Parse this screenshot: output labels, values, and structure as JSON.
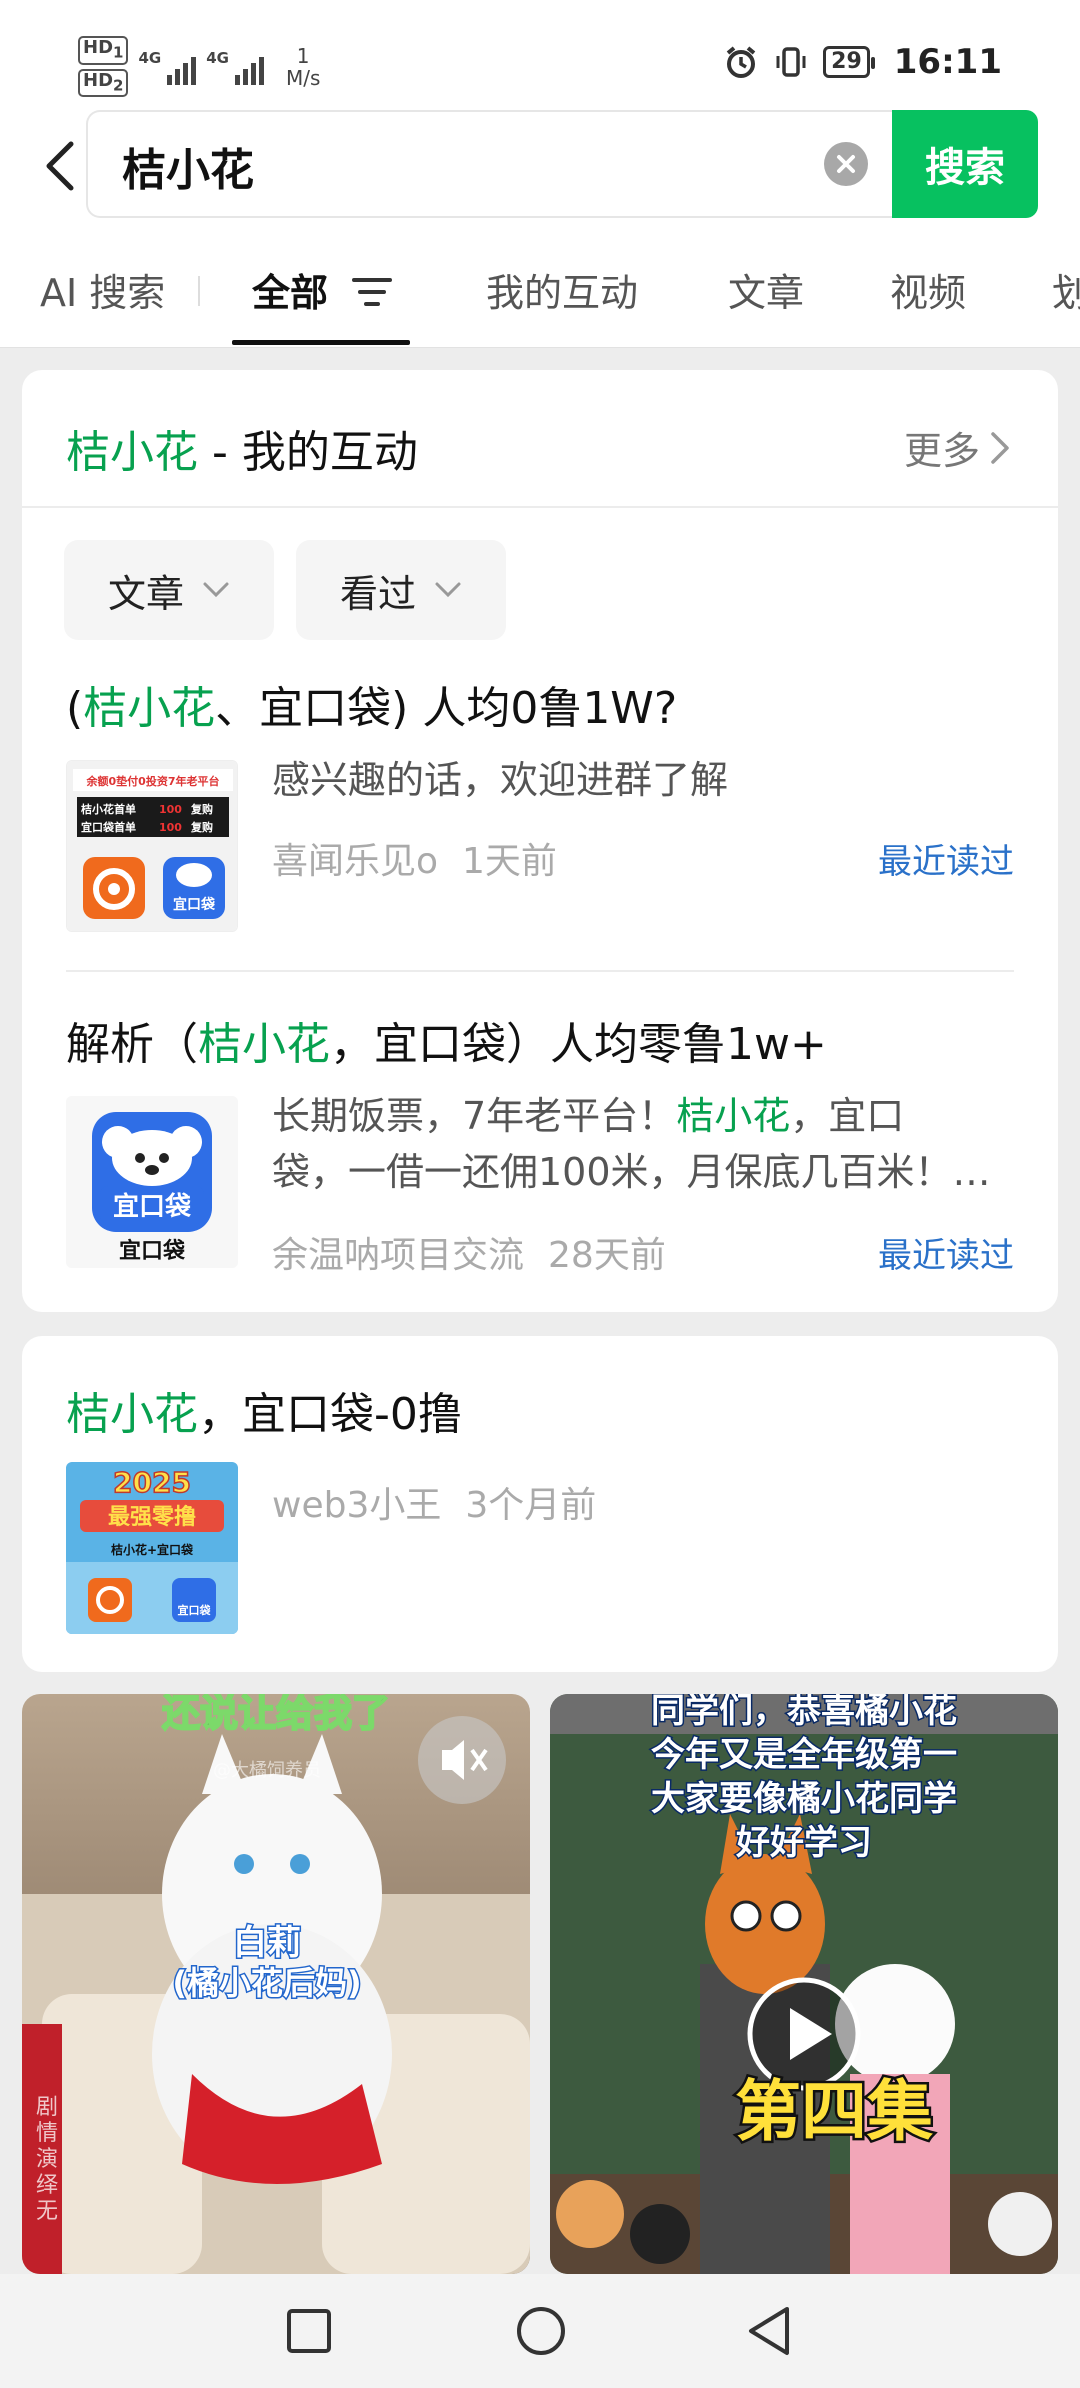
{
  "status_bar": {
    "hd1": "HD",
    "hd1_sub": "1",
    "hd2": "HD",
    "hd2_sub": "2",
    "net1": "4G",
    "net2": "4G",
    "speed_value": "1",
    "speed_unit": "M/s",
    "battery": "29",
    "time": "16:11"
  },
  "search": {
    "query": "桔小花",
    "button_label": "搜索"
  },
  "tabs": [
    {
      "label": "AI 搜索"
    },
    {
      "label": "全部"
    },
    {
      "label": "我的互动"
    },
    {
      "label": "文章"
    },
    {
      "label": "视频"
    },
    {
      "label": "划"
    }
  ],
  "interactions_card": {
    "title_keyword": "桔小花",
    "title_suffix": " - 我的互动",
    "more_label": "更多",
    "filters": [
      {
        "label": "文章"
      },
      {
        "label": "看过"
      }
    ],
    "items": [
      {
        "title_parts": [
          "(",
          "桔小花",
          "、宜口袋) 人均0鲁1W?"
        ],
        "snippet": "感兴趣的话，欢迎进群了解",
        "source": "喜闻乐见o",
        "time": "1天前",
        "tag": "最近读过",
        "thumb": {
          "line1": "余额0垫付0投资7年老平台",
          "row1_name": "桔小花首单",
          "row1_num": "100",
          "row1_action": "复购",
          "row2_name": "宜口袋首单",
          "row2_num": "100",
          "row2_action": "复购",
          "badge": "宜口袋"
        }
      },
      {
        "title_parts": [
          "解析（",
          "桔小花",
          "，宜口袋）人均零鲁1w+"
        ],
        "snippet_line1_pre": "长期饭票，7年老平台！",
        "snippet_line1_kw": "桔小花",
        "snippet_line1_post": "，宜口",
        "snippet_line2": "袋，一借一还佣100米，月保底几百米！…",
        "source": "余温呐项目交流",
        "time": "28天前",
        "tag": "最近读过",
        "thumb": {
          "app_label": "宜口袋",
          "caption": "宜口袋"
        }
      }
    ]
  },
  "article_card": {
    "title_keyword": "桔小花",
    "title_suffix": "，宜口袋-0撸",
    "source": "web3小王",
    "time": "3个月前",
    "thumb": {
      "year": "2025",
      "headline": "最强零撸",
      "sub": "桔小花+宜口袋",
      "badge": "宜口袋"
    }
  },
  "videos": [
    {
      "top_caption": "还说让给我了",
      "watermark": "@大橘饲养员",
      "name": "白莉",
      "role": "(橘小花后妈)",
      "side_note": "剧情演绎无"
    },
    {
      "caption_lines": [
        "同学们，恭喜橘小花",
        "今年又是全年级第一",
        "大家要像橘小花同学",
        "好好学习"
      ],
      "episode": "第四集"
    }
  ]
}
